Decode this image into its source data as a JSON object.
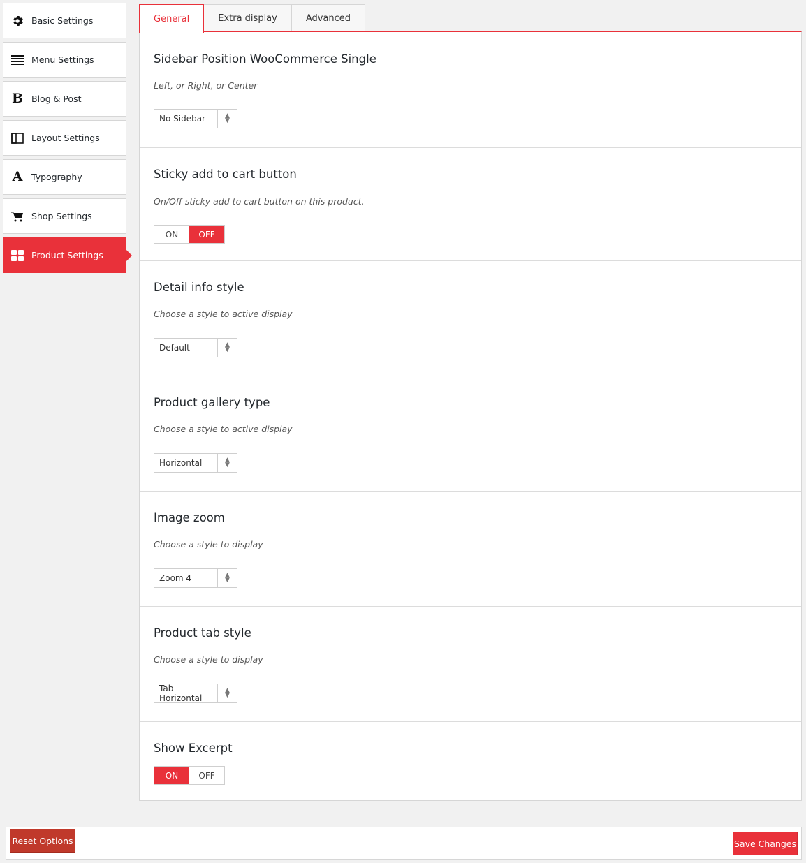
{
  "sidebar": {
    "items": [
      {
        "label": "Basic Settings",
        "icon": "gear-icon"
      },
      {
        "label": "Menu Settings",
        "icon": "menu-icon"
      },
      {
        "label": "Blog & Post",
        "icon": "bold-b-icon"
      },
      {
        "label": "Layout Settings",
        "icon": "layout-columns-icon"
      },
      {
        "label": "Typography",
        "icon": "typography-a-icon"
      },
      {
        "label": "Shop Settings",
        "icon": "cart-icon"
      },
      {
        "label": "Product Settings",
        "icon": "grid-icon",
        "active": true
      }
    ]
  },
  "tabs": [
    {
      "label": "General",
      "active": true
    },
    {
      "label": "Extra display"
    },
    {
      "label": "Advanced"
    }
  ],
  "sections": {
    "sidebar_position": {
      "title": "Sidebar Position WooCommerce Single",
      "desc": "Left, or Right, or Center",
      "value": "No Sidebar"
    },
    "sticky_cart": {
      "title": "Sticky add to cart button",
      "desc": "On/Off sticky add to cart button on this product.",
      "on_label": "ON",
      "off_label": "OFF",
      "state": "OFF"
    },
    "detail_info": {
      "title": "Detail info style",
      "desc": "Choose a style to active display",
      "value": "Default"
    },
    "gallery_type": {
      "title": "Product gallery type",
      "desc": "Choose a style to active display",
      "value": "Horizontal"
    },
    "image_zoom": {
      "title": "Image zoom",
      "desc": "Choose a style to display",
      "value": "Zoom 4"
    },
    "tab_style": {
      "title": "Product tab style",
      "desc": "Choose a style to display",
      "value": "Tab Horizontal"
    },
    "show_excerpt": {
      "title": "Show Excerpt",
      "on_label": "ON",
      "off_label": "OFF",
      "state": "ON"
    }
  },
  "footer": {
    "reset_label": "Reset Options",
    "save_label": "Save Changes"
  },
  "colors": {
    "accent": "#e9313a",
    "reset": "#c0392b"
  }
}
